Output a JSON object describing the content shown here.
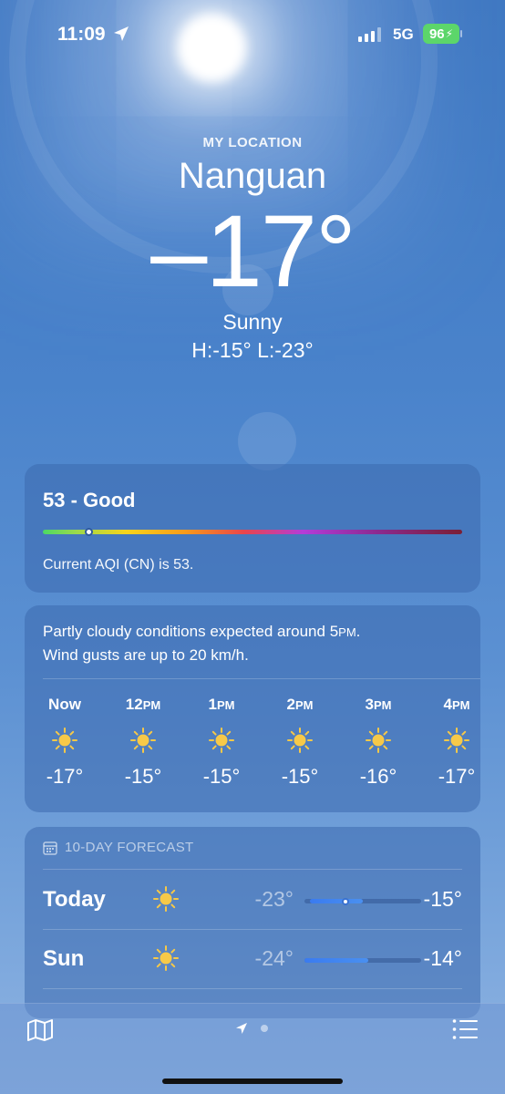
{
  "status": {
    "time": "11:09",
    "network": "5G",
    "battery": "96"
  },
  "header": {
    "subtitle": "MY LOCATION",
    "city": "Nanguan",
    "temperature": "–17°",
    "condition": "Sunny",
    "hi_lo": "H:-15°  L:-23°"
  },
  "aqi": {
    "title": "53 - Good",
    "description": "Current AQI (CN) is 53.",
    "level": 0.11
  },
  "hourly": {
    "summary_line1": "Partly cloudy conditions expected around 5",
    "summary_line1_suffix": "PM",
    "summary_line2": "Wind gusts are up to 20 km/h.",
    "hours": [
      {
        "label": "Now",
        "suffix": "",
        "temp": "-17°",
        "icon": "sun-icon"
      },
      {
        "label": "12",
        "suffix": "PM",
        "temp": "-15°",
        "icon": "sun-icon"
      },
      {
        "label": "1",
        "suffix": "PM",
        "temp": "-15°",
        "icon": "sun-icon"
      },
      {
        "label": "2",
        "suffix": "PM",
        "temp": "-15°",
        "icon": "sun-icon"
      },
      {
        "label": "3",
        "suffix": "PM",
        "temp": "-16°",
        "icon": "sun-icon"
      },
      {
        "label": "4",
        "suffix": "PM",
        "temp": "-17°",
        "icon": "sun-icon"
      }
    ]
  },
  "forecast": {
    "heading": "10-DAY FORECAST",
    "days": [
      {
        "day": "Today",
        "low": "-23°",
        "high": "-15°",
        "icon": "sun-icon",
        "range_start": 0.05,
        "range_end": 0.5,
        "current": 0.35
      },
      {
        "day": "Sun",
        "low": "-24°",
        "high": "-14°",
        "icon": "sun-icon",
        "range_start": 0.0,
        "range_end": 0.55
      }
    ]
  },
  "tabbar": {
    "icons": [
      "map-icon",
      "location-arrow-icon",
      "page-dot",
      "list-icon"
    ]
  },
  "colors": {
    "sun": "#f7c948",
    "battery": "#5cd66a",
    "range_bar": "#3a7bf0"
  }
}
